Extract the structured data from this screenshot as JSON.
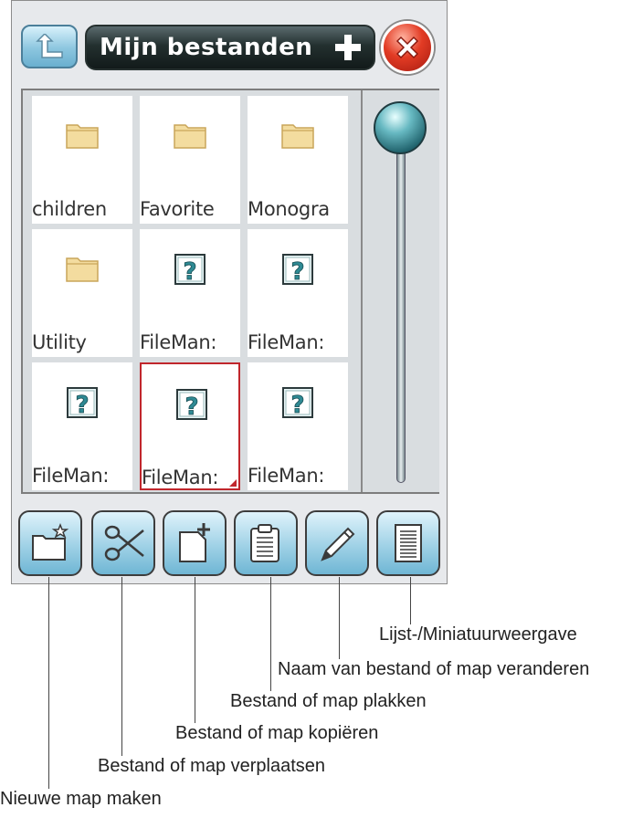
{
  "header": {
    "title": "Mijn bestanden"
  },
  "files": [
    {
      "name": "children",
      "icon": "folder-icon"
    },
    {
      "name": "Favorite",
      "icon": "folder-icon"
    },
    {
      "name": "Monogra",
      "icon": "folder-icon"
    },
    {
      "name": "Utility",
      "icon": "folder-icon"
    },
    {
      "name": "FileMan:",
      "icon": "unknown-file-icon"
    },
    {
      "name": "FileMan:",
      "icon": "unknown-file-icon"
    },
    {
      "name": "FileMan:",
      "icon": "unknown-file-icon"
    },
    {
      "name": "FileMan:",
      "icon": "unknown-file-icon",
      "selected": true
    },
    {
      "name": "FileMan:",
      "icon": "unknown-file-icon"
    }
  ],
  "toolbar": [
    {
      "icon": "new-folder-icon"
    },
    {
      "icon": "scissors-icon"
    },
    {
      "icon": "copy-icon"
    },
    {
      "icon": "paste-icon"
    },
    {
      "icon": "pencil-icon"
    },
    {
      "icon": "list-view-icon"
    }
  ],
  "callouts": {
    "list_thumbnail": "Lijst-/Miniatuurweergave",
    "rename": "Naam van bestand of map veranderen",
    "paste": "Bestand of map plakken",
    "copy": "Bestand of map kopiëren",
    "move": "Bestand of map verplaatsen",
    "new_folder": "Nieuwe map maken"
  },
  "colors": {
    "selection": "#c0262c",
    "folder": "#f0d89a",
    "button": "#9fd1e6",
    "close": "#e23b24"
  }
}
